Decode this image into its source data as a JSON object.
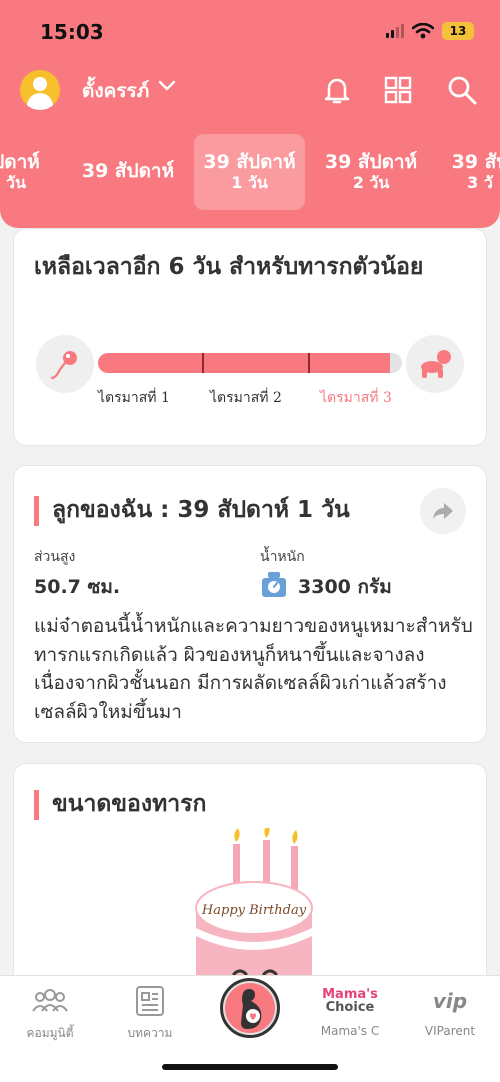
{
  "status_bar": {
    "time": "15:03",
    "battery": "13"
  },
  "header": {
    "profile_name": "ตั้งครรภ์",
    "weeks": [
      {
        "line1": "ปดาห์",
        "line2": "วัน"
      },
      {
        "line1": "39 สัปดาห์",
        "line2": ""
      },
      {
        "line1": "39 สัปดาห์",
        "line2": "1 วัน"
      },
      {
        "line1": "39 สัปดาห์",
        "line2": "2 วัน"
      },
      {
        "line1": "39 สัป",
        "line2": "3 วั"
      }
    ]
  },
  "countdown": {
    "text": "เหลือเวลาอีก 6 วัน สำหรับทารกตัวน้อย",
    "trimesters": [
      "ไตรมาสที่ 1",
      "ไตรมาสที่ 2",
      "ไตรมาสที่ 3"
    ],
    "current_trimester": 3
  },
  "baby": {
    "title": "ลูกของฉัน : 39 สัปดาห์ 1  วัน",
    "height_label": "ส่วนสูง",
    "height_value": "50.7 ซม.",
    "weight_label": "น้ำหนัก",
    "weight_value": "3300 กรัม",
    "description": "แม่จ๋าตอนนี้น้ำหนักและความยาวของหนูเหมาะสำหรับทารกแรกเกิดแล้ว ผิวของหนูก็หนาขึ้นและจางลง เนื่องจากผิวชั้นนอก มีการผลัดเซลล์ผิวเก่าแล้วสร้างเซลล์ผิวใหม่ขึ้นมา"
  },
  "size_section": {
    "title": "ขนาดของทารก",
    "cake_text": "Happy Birthday"
  },
  "bottom_nav": {
    "community": "คอมมูนิตี้",
    "articles": "บทความ",
    "mamas_choice_logo_1": "Mama's",
    "mamas_choice_logo_2": "Choice",
    "mamas_choice": "Mama's C",
    "viparent_logo": "vip",
    "viparent": "VIParent"
  },
  "colors": {
    "primary": "#f87a80",
    "accent_yellow": "#f7c02b",
    "text": "#333333"
  }
}
